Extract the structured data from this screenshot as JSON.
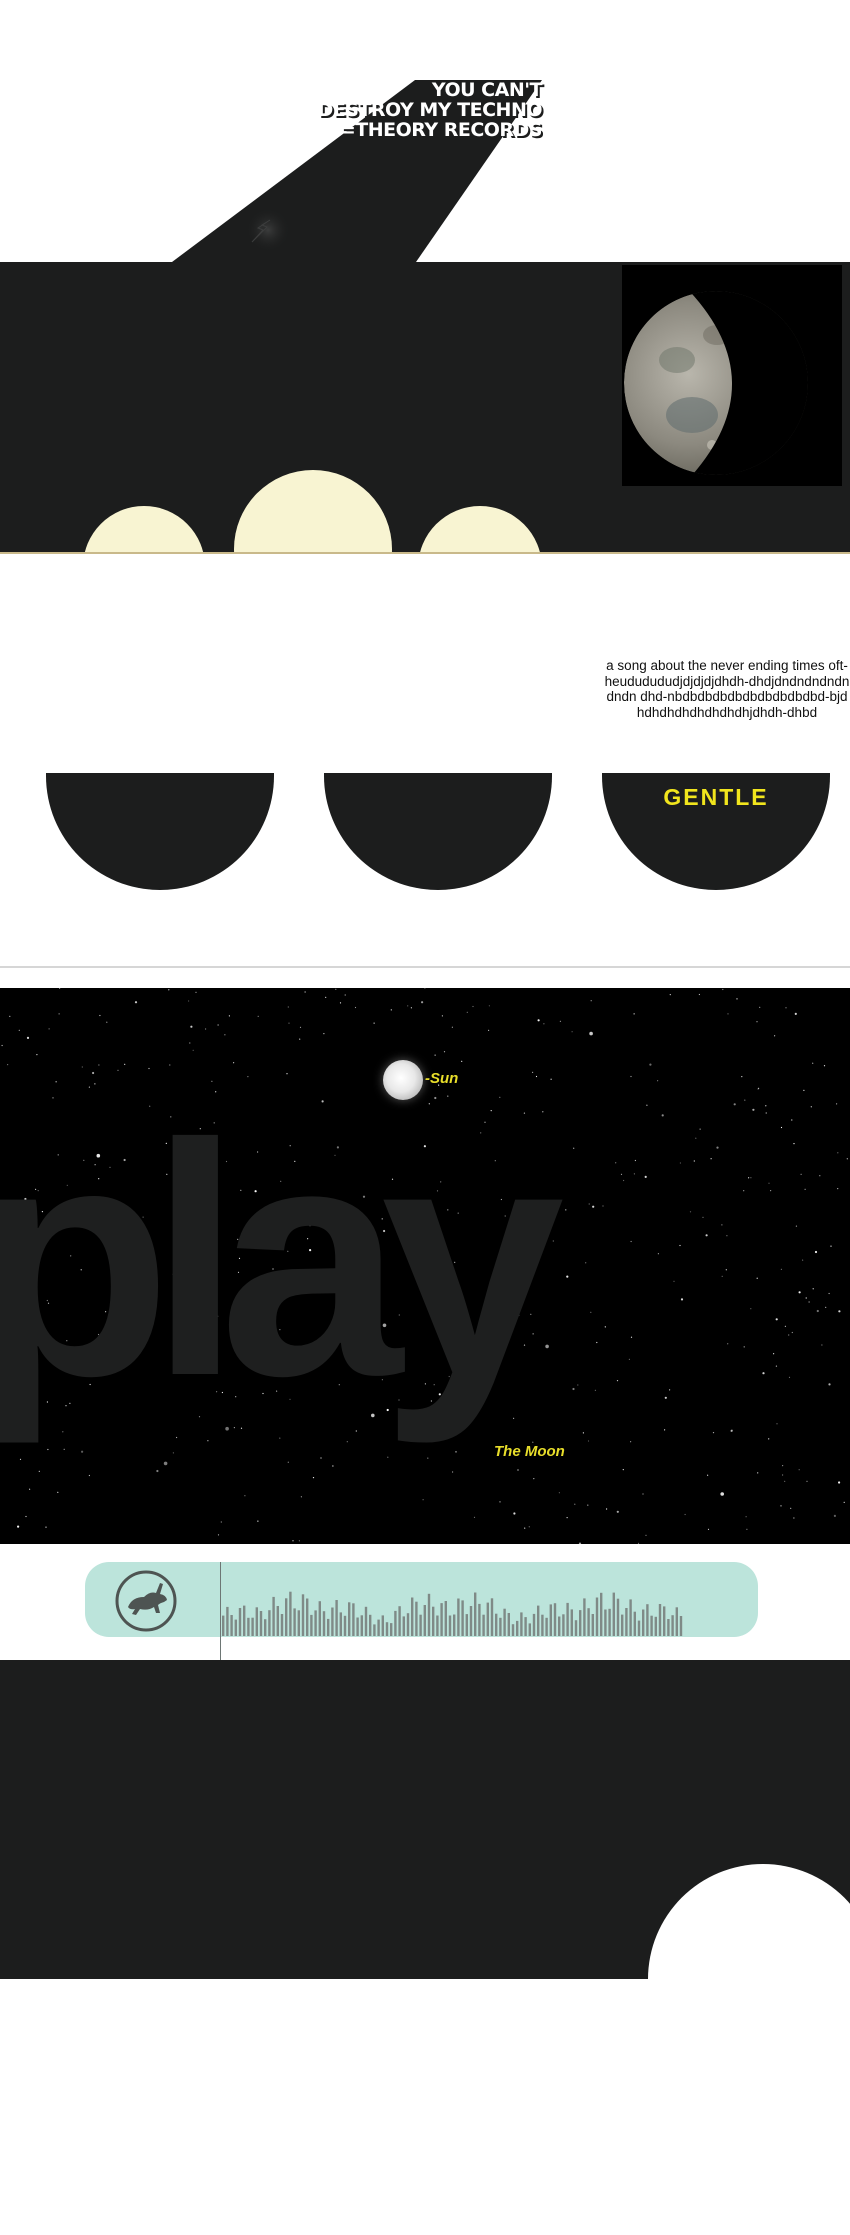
{
  "header": {
    "title_lines": [
      "YOU CAN'T",
      "DESTROY MY TECHNO",
      "=THEORY RECORDS"
    ],
    "pointer_icon": "cursor-arrow-icon"
  },
  "band1": {
    "image_icon": "half-moon-photo",
    "accent_color": "#f8f4d2"
  },
  "cards": {
    "song_text": "a song about the never ending times oft-heududududjdjdjdjdhdh-dhdjdndndndndndndn dhd-nbdbdbdbdbdbdbdbdbdbd-bjdhdhdhdhdhdhdhdhjdhdh-dhbd",
    "label": "GENTLE",
    "label_color": "#f1e51d"
  },
  "space": {
    "big_word": "play",
    "sun_label": "-Sun",
    "moon_label": "The Moon",
    "label_color": "#e8de2a"
  },
  "player": {
    "logo_icon": "running-rabbit-icon",
    "waveform_icon": "audio-waveform",
    "background": "#bce4db"
  },
  "theme": {
    "dark": "#1c1d1d",
    "light": "#ffffff"
  }
}
